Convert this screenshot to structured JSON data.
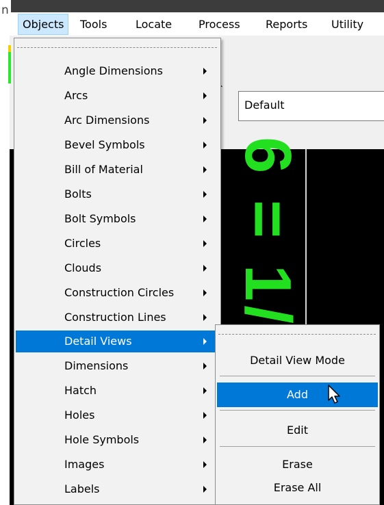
{
  "window": {
    "title_fragment": "n,"
  },
  "menubar": {
    "items": [
      {
        "label": "Objects",
        "active": true
      },
      {
        "label": "Tools"
      },
      {
        "label": "Locate"
      },
      {
        "label": "Process"
      },
      {
        "label": "Reports"
      },
      {
        "label": "Utility"
      }
    ]
  },
  "toolbar": {
    "combo_value": "Default"
  },
  "drawing": {
    "scale_text": "6 = 1/2",
    "text_color": "#22e020"
  },
  "objects_menu": {
    "items": [
      {
        "label": "Angle Dimensions",
        "has_submenu": true
      },
      {
        "label": "Arcs",
        "has_submenu": true
      },
      {
        "label": "Arc Dimensions",
        "has_submenu": true
      },
      {
        "label": "Bevel Symbols",
        "has_submenu": true
      },
      {
        "label": "Bill of Material",
        "has_submenu": true
      },
      {
        "label": "Bolts",
        "has_submenu": true
      },
      {
        "label": "Bolt Symbols",
        "has_submenu": true
      },
      {
        "label": "Circles",
        "has_submenu": true
      },
      {
        "label": "Clouds",
        "has_submenu": true
      },
      {
        "label": "Construction Circles",
        "has_submenu": true
      },
      {
        "label": "Construction Lines",
        "has_submenu": true
      },
      {
        "label": "Detail Views",
        "has_submenu": true,
        "selected": true
      },
      {
        "label": "Dimensions",
        "has_submenu": true
      },
      {
        "label": "Hatch",
        "has_submenu": true
      },
      {
        "label": "Holes",
        "has_submenu": true
      },
      {
        "label": "Hole Symbols",
        "has_submenu": true
      },
      {
        "label": "Images",
        "has_submenu": true
      },
      {
        "label": "Labels",
        "has_submenu": true
      }
    ]
  },
  "detail_views_submenu": {
    "items": [
      {
        "label": "Detail View Mode"
      },
      {
        "label": "Add",
        "selected": true
      },
      {
        "label": "Edit"
      },
      {
        "label": "Erase"
      },
      {
        "label": "Erase All"
      }
    ]
  },
  "colors": {
    "selection": "#0078d7",
    "menubar_active": "#cce8ff"
  }
}
